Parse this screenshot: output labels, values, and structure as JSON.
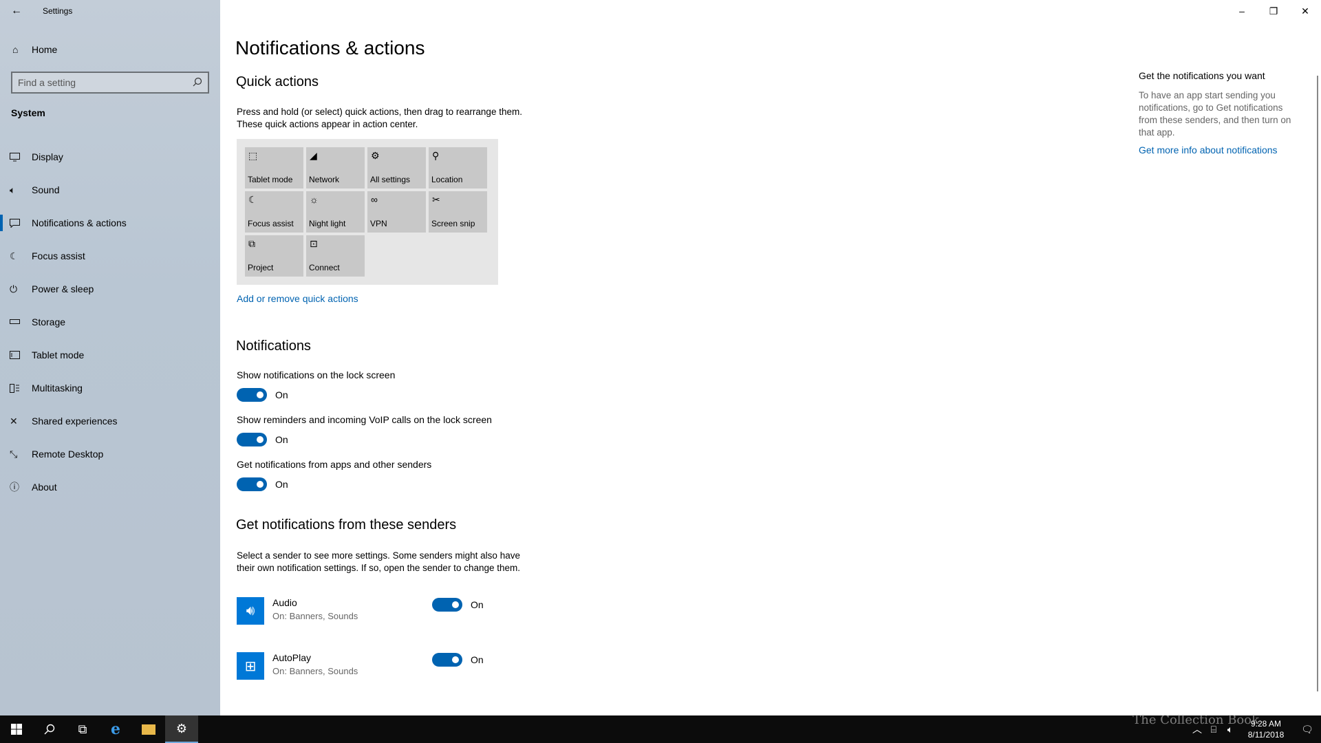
{
  "window": {
    "title": "Settings",
    "controls": {
      "minimize": "–",
      "restore": "❐",
      "close": "✕"
    }
  },
  "sidebar": {
    "back": "←",
    "home": {
      "label": "Home",
      "icon": "home-icon"
    },
    "search": {
      "placeholder": "Find a setting",
      "icon": "search-icon"
    },
    "section": "System",
    "items": [
      {
        "label": "Display",
        "icon": "display-icon"
      },
      {
        "label": "Sound",
        "icon": "speaker-icon"
      },
      {
        "label": "Notifications & actions",
        "icon": "notification-icon",
        "selected": true
      },
      {
        "label": "Focus assist",
        "icon": "moon-icon"
      },
      {
        "label": "Power & sleep",
        "icon": "power-icon"
      },
      {
        "label": "Storage",
        "icon": "storage-icon"
      },
      {
        "label": "Tablet mode",
        "icon": "tablet-icon"
      },
      {
        "label": "Multitasking",
        "icon": "multitasking-icon"
      },
      {
        "label": "Shared experiences",
        "icon": "shared-icon"
      },
      {
        "label": "Remote Desktop",
        "icon": "remote-desktop-icon"
      },
      {
        "label": "About",
        "icon": "info-icon"
      }
    ]
  },
  "main": {
    "title": "Notifications & actions",
    "quick_actions": {
      "heading": "Quick actions",
      "description_1": "Press and hold (or select) quick actions, then drag to rearrange them.",
      "description_2": "These quick actions appear in action center.",
      "tiles": [
        {
          "label": "Tablet mode",
          "icon": "tablet-mode-icon"
        },
        {
          "label": "Network",
          "icon": "network-icon"
        },
        {
          "label": "All settings",
          "icon": "gear-icon"
        },
        {
          "label": "Location",
          "icon": "location-icon"
        },
        {
          "label": "Focus assist",
          "icon": "moon-icon"
        },
        {
          "label": "Night light",
          "icon": "sun-icon"
        },
        {
          "label": "VPN",
          "icon": "vpn-icon"
        },
        {
          "label": "Screen snip",
          "icon": "snip-icon"
        },
        {
          "label": "Project",
          "icon": "project-icon"
        },
        {
          "label": "Connect",
          "icon": "connect-icon"
        }
      ],
      "link": "Add or remove quick actions"
    },
    "notifications": {
      "heading": "Notifications",
      "settings": [
        {
          "label": "Show notifications on the lock screen",
          "state": "On"
        },
        {
          "label": "Show reminders and incoming VoIP calls on the lock screen",
          "state": "On"
        },
        {
          "label": "Get notifications from apps and other senders",
          "state": "On"
        }
      ]
    },
    "senders": {
      "heading": "Get notifications from these senders",
      "description_1": "Select a sender to see more settings. Some senders might also have",
      "description_2": "their own notification settings. If so, open the sender to change them.",
      "items": [
        {
          "name": "Audio",
          "sub": "On: Banners, Sounds",
          "state": "On",
          "icon": "speaker-icon"
        },
        {
          "name": "AutoPlay",
          "sub": "On: Banners, Sounds",
          "state": "On",
          "icon": "autoplay-icon"
        }
      ]
    },
    "right_panel": {
      "title": "Get the notifications you want",
      "description": "To have an app start sending you notifications, go to Get notifications from these senders, and then turn on that app.",
      "link": "Get more info about notifications"
    }
  },
  "taskbar": {
    "clock_time": "9:28 AM",
    "clock_date": "8/11/2018",
    "watermark": "The Collection Book"
  },
  "colors": {
    "accent": "#0063b1",
    "sidebar_bg": "#bcc8d4",
    "taskbar_bg": "#0c0c0c"
  }
}
